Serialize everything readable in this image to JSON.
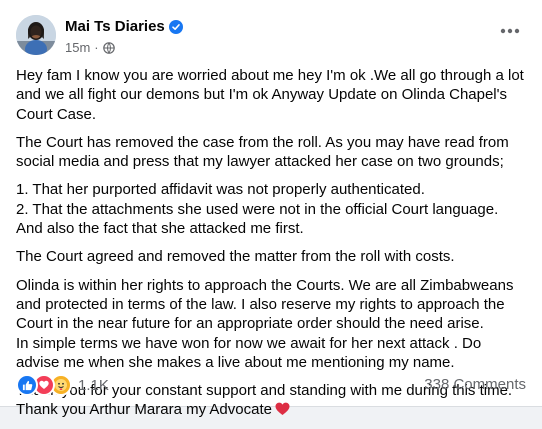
{
  "post": {
    "author": "Mai Ts Diaries",
    "timestamp": "15m",
    "separator": "·",
    "paragraphs": [
      "Hey fam I know you are worried about me hey I'm ok .We all go through a lot and we all fight our demons but I'm ok Anyway Update on Olinda Chapel's Court Case.",
      "The Court has removed the case from the roll. As you may have read from social media and press that my lawyer attacked her case on two grounds;",
      "1. That her purported affidavit was not properly authenticated.\n2. That the attachments she used were not in the official Court language.\nAnd also the fact that she attacked me first.",
      "The Court agreed and removed the matter from the roll with costs.",
      "Olinda is within her rights to approach the Courts. We are all Zimbabweans and protected in terms of the law. I also reserve my rights to approach the Court in the near future for an appropriate order should the need arise.\nIn simple terms we have won for now we await for her next attack . Do advise me when she makes a live about me mentioning my name.",
      "Thank you for your constant support and standing with me during this time.\nThank you Arthur Marara my Advocate"
    ],
    "reaction_count": "1.1K",
    "comment_count": "338 Comments"
  },
  "colors": {
    "like": "#1877f2",
    "love": "#f33e58",
    "care": "#f7b125",
    "heart_emoji": "#dd2e44",
    "secondary_text": "#65676b"
  },
  "icons": [
    "verified-badge-icon",
    "globe-icon",
    "more-options-icon",
    "like-reaction-icon",
    "love-reaction-icon",
    "care-reaction-icon",
    "red-heart-emoji-icon"
  ]
}
